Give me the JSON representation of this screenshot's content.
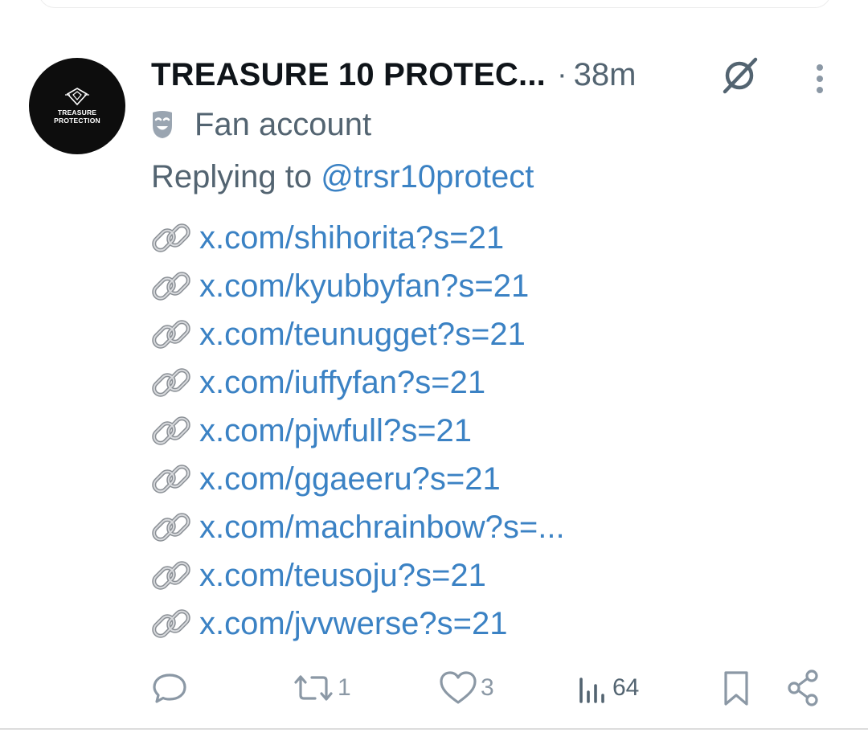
{
  "tweet": {
    "author": {
      "display_name": "TREASURE 10 PROTEC...",
      "avatar_text_line1": "TREASURE",
      "avatar_text_line2": "PROTECTION"
    },
    "separator": "·",
    "timestamp": "38m",
    "label": {
      "icon": "theater-mask-icon",
      "text": "Fan account"
    },
    "reply": {
      "prefix": "Replying to",
      "handle": "@trsr10protect"
    },
    "links": [
      "x.com/shihorita?s=21",
      "x.com/kyubbyfan?s=21",
      "x.com/teunugget?s=21",
      "x.com/iuffyfan?s=21",
      "x.com/pjwfull?s=21",
      "x.com/ggaeeru?s=21",
      "x.com/machrainbow?s=...",
      "x.com/teusoju?s=21",
      "x.com/jvvwerse?s=21"
    ],
    "actions": {
      "reply_count": "",
      "repost_count": "1",
      "like_count": "3",
      "views_count": "64"
    }
  },
  "colors": {
    "text_primary": "#0f1419",
    "text_secondary": "#536471",
    "link": "#3b82c4",
    "icon_muted": "#8b98a5"
  },
  "icons": [
    "grok-icon",
    "more-vertical-icon",
    "link-chain-icon",
    "reply-icon",
    "repost-icon",
    "like-icon",
    "views-icon",
    "bookmark-icon",
    "share-icon"
  ]
}
